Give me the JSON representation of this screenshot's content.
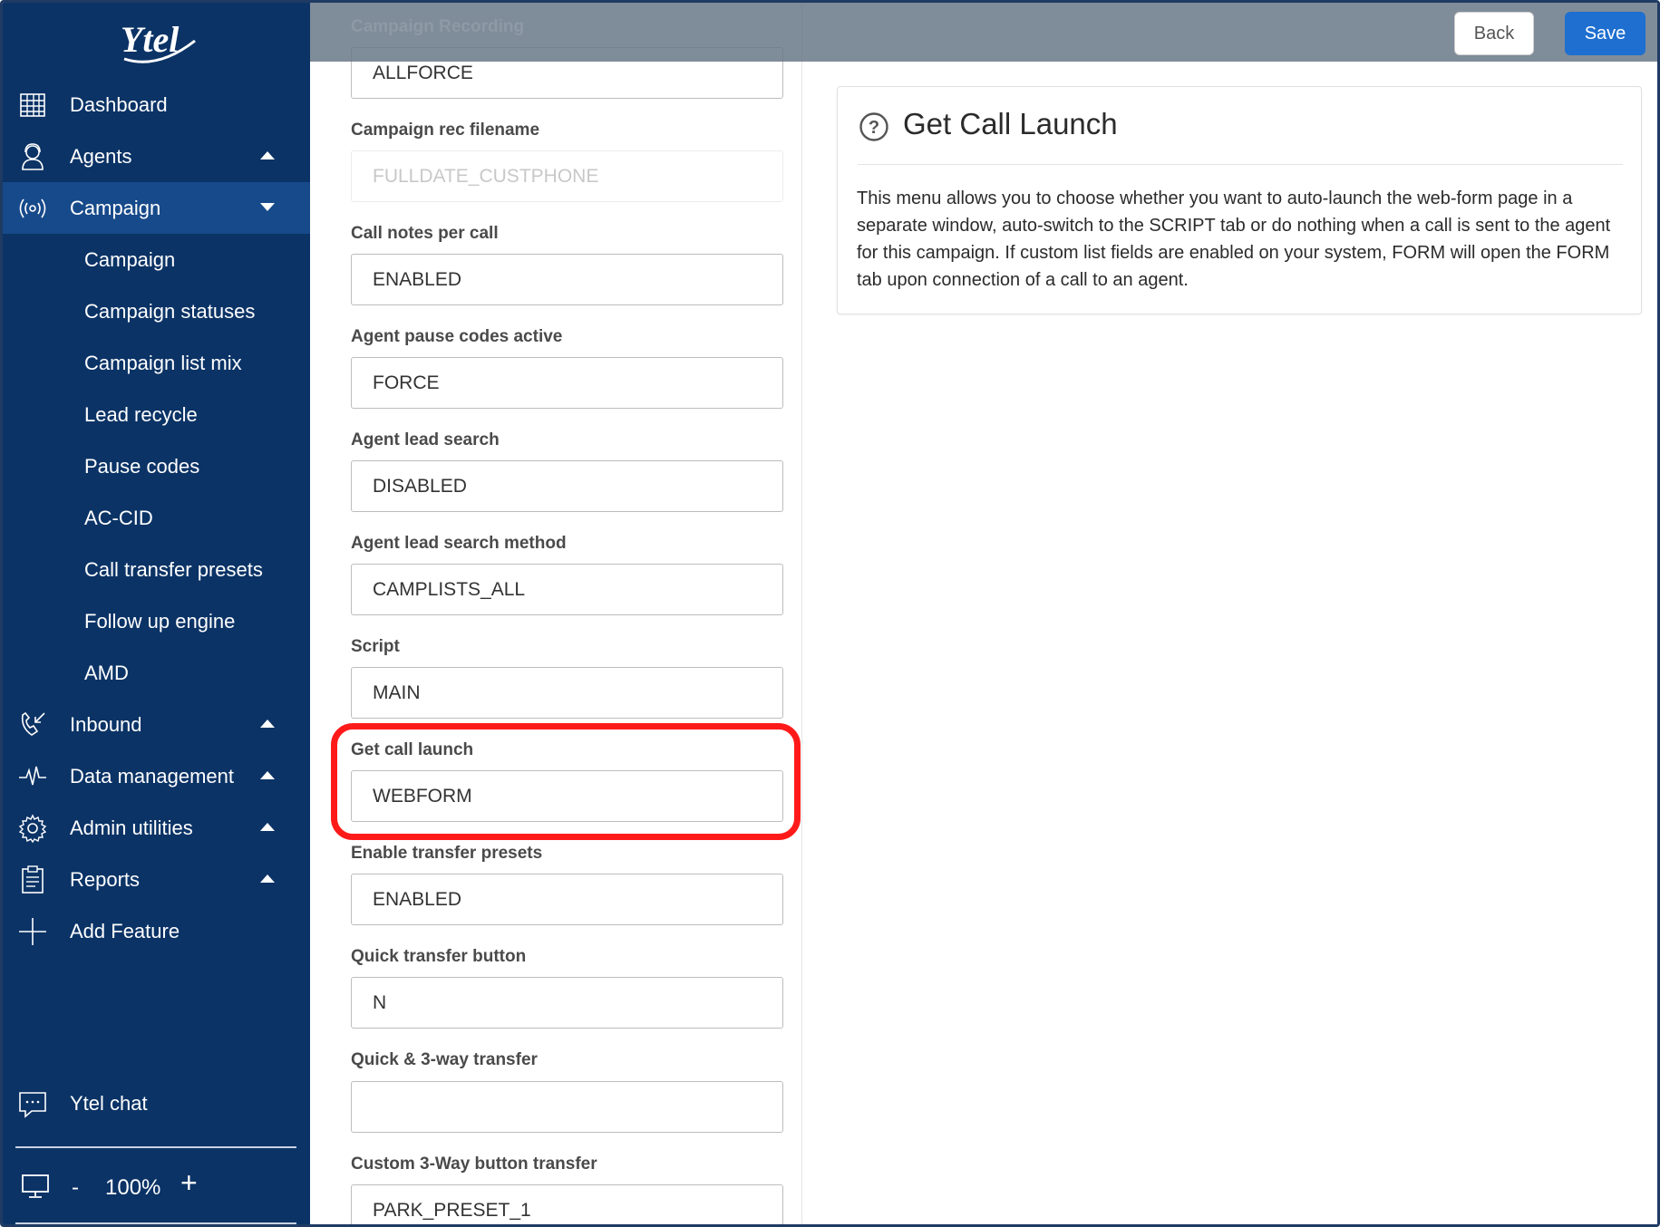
{
  "brand": {
    "logo_text": "Ytel"
  },
  "sidebar": {
    "items": [
      {
        "label": "Dashboard",
        "icon": "dashboard-icon"
      },
      {
        "label": "Agents",
        "icon": "agent-icon",
        "caret": "up"
      },
      {
        "label": "Campaign",
        "icon": "broadcast-icon",
        "caret": "down"
      },
      {
        "label": "Inbound",
        "icon": "inbound-call-icon",
        "caret": "up"
      },
      {
        "label": "Data management",
        "icon": "pulse-icon",
        "caret": "up"
      },
      {
        "label": "Admin utilities",
        "icon": "gear-icon",
        "caret": "up"
      },
      {
        "label": "Reports",
        "icon": "clipboard-icon",
        "caret": "up"
      },
      {
        "label": "Add Feature",
        "icon": "plus-icon"
      }
    ],
    "campaign_sub": [
      "Campaign",
      "Campaign statuses",
      "Campaign list mix",
      "Lead recycle",
      "Pause codes",
      "AC-CID",
      "Call transfer presets",
      "Follow up engine",
      "AMD"
    ],
    "chat_label": "Ytel chat",
    "zoom": {
      "minus": "-",
      "value": "100%",
      "plus": "+"
    }
  },
  "topbar": {
    "ghost_label": "Campaign Recording",
    "back_label": "Back",
    "save_label": "Save"
  },
  "form": {
    "fields": [
      {
        "label": "",
        "value": "ALLFORCE"
      },
      {
        "label": "Campaign rec filename",
        "value": "FULLDATE_CUSTPHONE"
      },
      {
        "label": "Call notes per call",
        "value": "ENABLED"
      },
      {
        "label": "Agent pause codes active",
        "value": "FORCE"
      },
      {
        "label": "Agent lead search",
        "value": "DISABLED"
      },
      {
        "label": "Agent lead search method",
        "value": "CAMPLISTS_ALL"
      },
      {
        "label": "Script",
        "value": "MAIN"
      },
      {
        "label": "Get call launch",
        "value": "WEBFORM"
      },
      {
        "label": "Enable transfer presets",
        "value": "ENABLED"
      },
      {
        "label": "Quick transfer button",
        "value": "N"
      },
      {
        "label": "Quick & 3-way transfer",
        "value": ""
      },
      {
        "label": "Custom 3-Way button transfer",
        "value": "PARK_PRESET_1"
      }
    ]
  },
  "help": {
    "title": "Get Call Launch",
    "body": "This menu allows you to choose whether you want to auto-launch the web-form page in a separate window, auto-switch to the SCRIPT tab or do nothing when a call is sent to the agent for this campaign. If custom list fields are enabled on your system, FORM will open the FORM tab upon connection of a call to an agent."
  },
  "colors": {
    "sidebar_bg": "#0b3366",
    "sidebar_active": "#174a8a",
    "save_button": "#1e6fd0",
    "highlight": "#ff1a1a"
  }
}
